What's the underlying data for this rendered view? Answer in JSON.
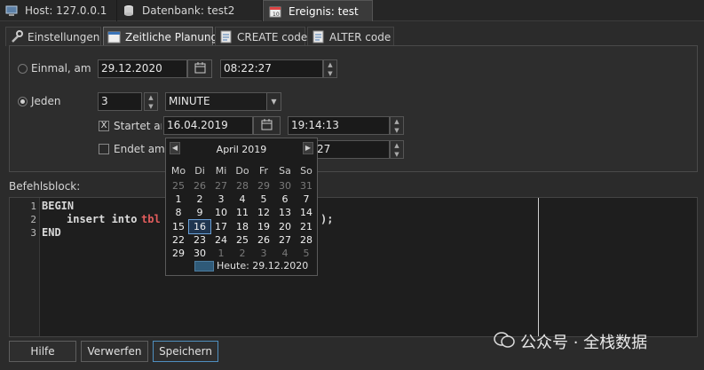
{
  "tabs": [
    {
      "label": "Host: 127.0.0.1",
      "icon": "host-icon"
    },
    {
      "label": "Datenbank: test2",
      "icon": "database-icon"
    },
    {
      "label": "Ereignis: test",
      "icon": "calendar-icon"
    }
  ],
  "subtabs": [
    {
      "label": "Einstellungen",
      "icon": "wrench-icon"
    },
    {
      "label": "Zeitliche Planung",
      "icon": "calendar-icon"
    },
    {
      "label": "CREATE code",
      "icon": "code-icon"
    },
    {
      "label": "ALTER code",
      "icon": "code-icon"
    }
  ],
  "schedule": {
    "once_label": "Einmal, am",
    "once_date": "29.12.2020",
    "once_time": "08:22:27",
    "every_label": "Jeden",
    "every_value": "3",
    "every_unit": "MINUTE",
    "starts_label": "Startet am:",
    "starts_checked": "X",
    "starts_date": "16.04.2019",
    "starts_time": "19:14:13",
    "ends_label": "Endet am:",
    "ends_time_partial": "27"
  },
  "body_label": "Befehlsblock:",
  "code": {
    "line_numbers": [
      "1",
      "2",
      "3"
    ],
    "line1": "BEGIN",
    "line2_kw": "insert into",
    "line2_tbl": "tbl",
    "line2_end": ");",
    "line3": "END"
  },
  "calendar": {
    "month": "April 2019",
    "weekdays": [
      "Mo",
      "Di",
      "Mi",
      "Do",
      "Fr",
      "Sa",
      "So"
    ],
    "weeks": [
      [
        "25",
        "26",
        "27",
        "28",
        "29",
        "30",
        "31"
      ],
      [
        "1",
        "2",
        "3",
        "4",
        "5",
        "6",
        "7"
      ],
      [
        "8",
        "9",
        "10",
        "11",
        "12",
        "13",
        "14"
      ],
      [
        "15",
        "16",
        "17",
        "18",
        "19",
        "20",
        "21"
      ],
      [
        "22",
        "23",
        "24",
        "25",
        "26",
        "27",
        "28"
      ],
      [
        "29",
        "30",
        "1",
        "2",
        "3",
        "4",
        "5"
      ]
    ],
    "selected": "16",
    "today": "Heute: 29.12.2020"
  },
  "buttons": {
    "help": "Hilfe",
    "discard": "Verwerfen",
    "save": "Speichern"
  },
  "watermark": "公众号 · 全栈数据",
  "colors": {
    "table_name": "#e35d5d",
    "selection": "#6aa0d8",
    "today_swatch": "#2f5a78"
  }
}
